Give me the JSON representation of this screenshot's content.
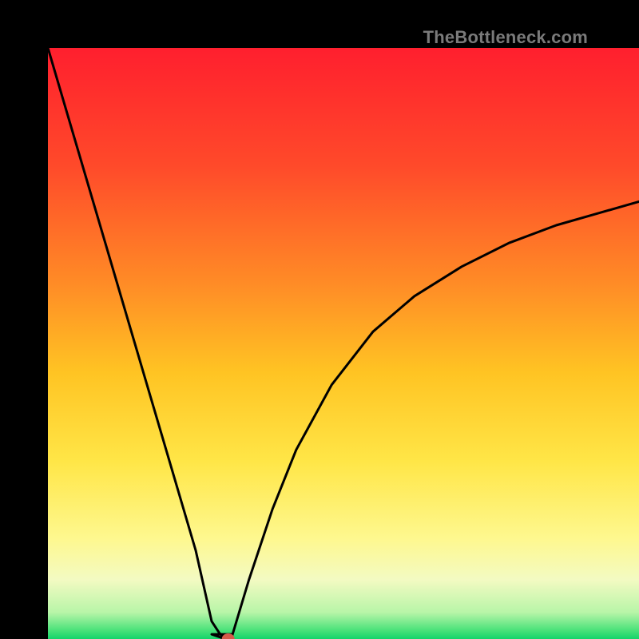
{
  "watermark": "TheBottleneck.com",
  "chart_data": {
    "type": "line",
    "title": "",
    "xlabel": "",
    "ylabel": "",
    "xlim": [
      0,
      1
    ],
    "ylim": [
      0,
      1
    ],
    "minimum_x": 0.3,
    "marker": {
      "x": 0.305,
      "y": 0.0,
      "color": "#d55a4a",
      "rx": 8,
      "ry": 7
    },
    "series": [
      {
        "name": "bottleneck-curve",
        "segment": "left",
        "x": [
          0.0,
          0.05,
          0.1,
          0.15,
          0.2,
          0.25,
          0.277,
          0.29,
          0.3
        ],
        "y": [
          1.0,
          0.83,
          0.66,
          0.49,
          0.32,
          0.15,
          0.03,
          0.01,
          0.0
        ]
      },
      {
        "name": "bottleneck-curve",
        "segment": "flat",
        "x": [
          0.277,
          0.31
        ],
        "y": [
          0.008,
          0.008
        ]
      },
      {
        "name": "bottleneck-curve",
        "segment": "right",
        "x": [
          0.31,
          0.34,
          0.38,
          0.42,
          0.48,
          0.55,
          0.62,
          0.7,
          0.78,
          0.86,
          0.93,
          1.0
        ],
        "y": [
          0.0,
          0.1,
          0.22,
          0.32,
          0.43,
          0.52,
          0.58,
          0.63,
          0.67,
          0.7,
          0.72,
          0.74
        ]
      }
    ],
    "gradient_stops": [
      {
        "offset": 0.0,
        "color": "#ff1f2e"
      },
      {
        "offset": 0.2,
        "color": "#ff4a2a"
      },
      {
        "offset": 0.4,
        "color": "#ff8c26"
      },
      {
        "offset": 0.55,
        "color": "#ffc423"
      },
      {
        "offset": 0.7,
        "color": "#ffe647"
      },
      {
        "offset": 0.83,
        "color": "#fef88f"
      },
      {
        "offset": 0.9,
        "color": "#f3fac2"
      },
      {
        "offset": 0.955,
        "color": "#b8f5a8"
      },
      {
        "offset": 0.985,
        "color": "#4be27a"
      },
      {
        "offset": 1.0,
        "color": "#14d46a"
      }
    ]
  }
}
